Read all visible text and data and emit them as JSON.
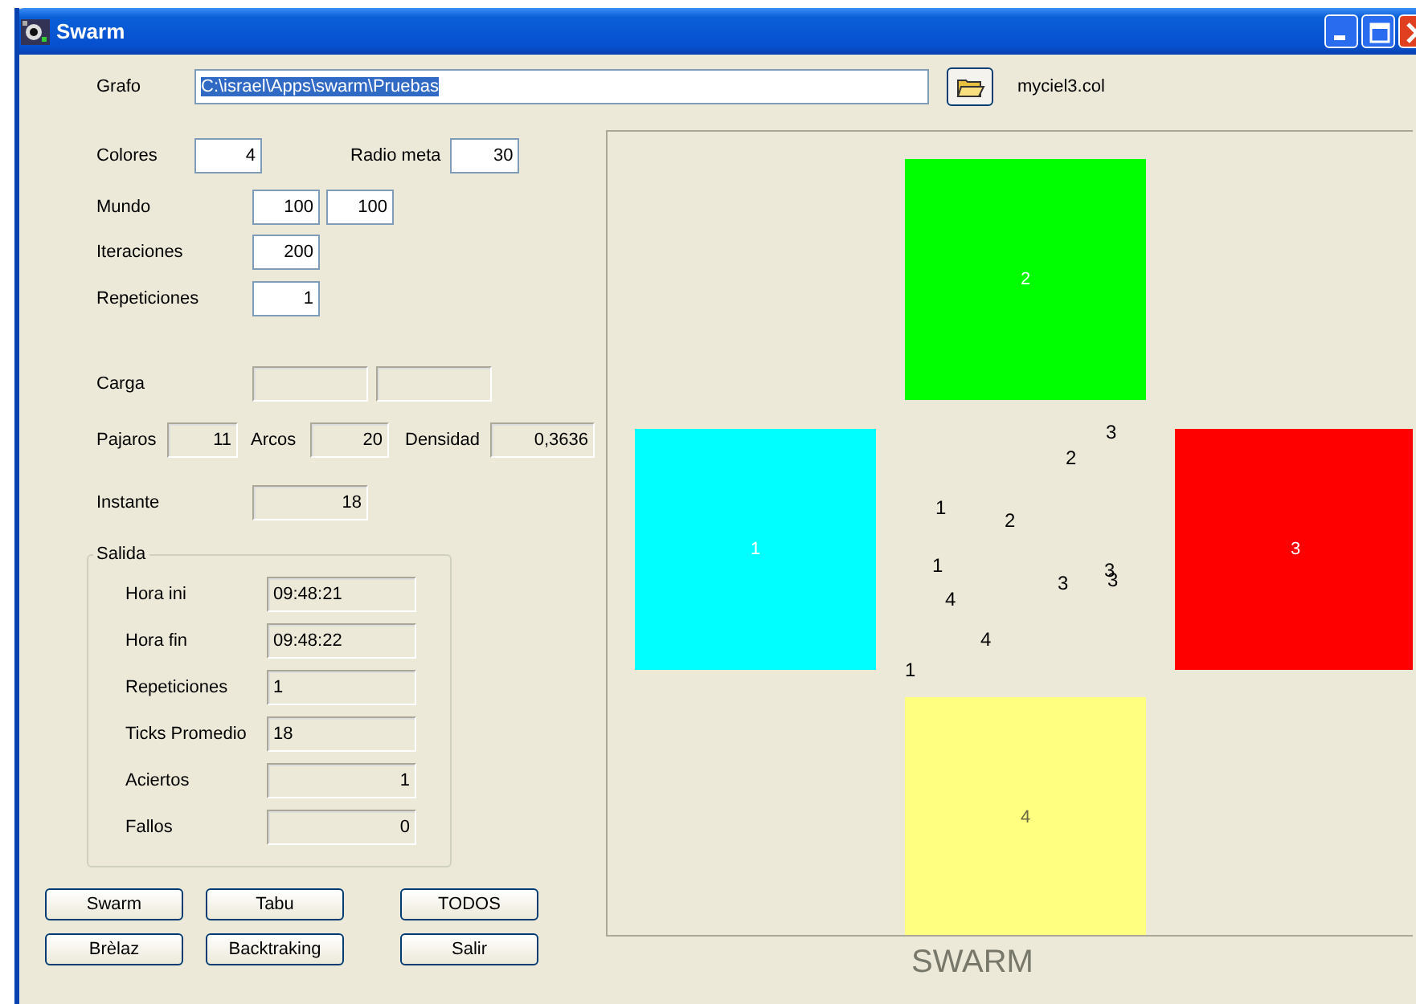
{
  "window": {
    "title": "Swarm"
  },
  "grafo": {
    "label": "Grafo",
    "value": "C:\\israel\\Apps\\swarm\\Pruebas",
    "text_selected": true,
    "file": "myciel3.col"
  },
  "colores": {
    "label": "Colores",
    "value": "4"
  },
  "radio_meta": {
    "label": "Radio meta",
    "value": "30"
  },
  "mundo": {
    "label": "Mundo",
    "values": [
      "100",
      "100"
    ]
  },
  "iteraciones": {
    "label": "Iteraciones",
    "value": "200"
  },
  "repeticiones": {
    "label": "Repeticiones",
    "value": "1"
  },
  "carga": {
    "label": "Carga",
    "disabled": true
  },
  "stats": [
    {
      "label": "Pajaros",
      "value": "11"
    },
    {
      "label": "Arcos",
      "value": "20"
    },
    {
      "label": "Densidad",
      "value": "0,3636"
    }
  ],
  "instante": {
    "label": "Instante",
    "value": "18"
  },
  "salida": {
    "title": "Salida",
    "rows": [
      {
        "label": "Hora ini",
        "value": "09:48:21",
        "kind": "text"
      },
      {
        "label": "Hora fin",
        "value": "09:48:22",
        "kind": "text"
      },
      {
        "label": "Repeticiones",
        "value": "1",
        "kind": "text"
      },
      {
        "label": "Ticks Promedio",
        "value": "18",
        "kind": "text"
      },
      {
        "label": "Aciertos",
        "value": "1",
        "kind": "number"
      },
      {
        "label": "Fallos",
        "value": "0",
        "kind": "number"
      }
    ]
  },
  "buttons": [
    {
      "label": "Swarm"
    },
    {
      "label": "Tabu"
    },
    {
      "label": "TODOS"
    },
    {
      "label": "Brèlaz"
    },
    {
      "label": "Backtraking"
    },
    {
      "label": "Salir"
    }
  ],
  "canvas": {
    "regions": [
      {
        "label": "2",
        "color": "#00ff00"
      },
      {
        "label": "1",
        "color": "#00ffff"
      },
      {
        "label": "3",
        "color": "#ff0000"
      },
      {
        "label": "4",
        "color": "#ffff80"
      }
    ],
    "birds": [
      {
        "label": "3"
      },
      {
        "label": "2"
      },
      {
        "label": "1"
      },
      {
        "label": "2"
      },
      {
        "label": "1"
      },
      {
        "label": "4"
      },
      {
        "label": "3"
      },
      {
        "label": "3"
      },
      {
        "label": "3"
      },
      {
        "label": "4"
      },
      {
        "label": "1"
      }
    ],
    "caption": "SWARM"
  }
}
